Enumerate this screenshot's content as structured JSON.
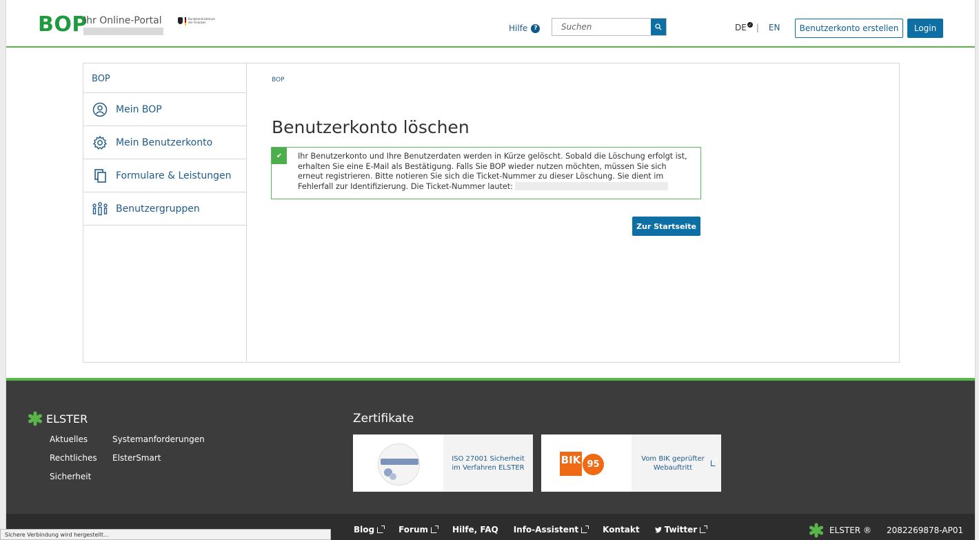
{
  "header": {
    "logo": "BOP",
    "portal_label": "Ihr Online-Portal",
    "ministry_text": "Bundesministerium der Finanzen",
    "help_label": "Hilfe",
    "search_placeholder": "Suchen",
    "lang_de": "DE",
    "lang_sep": "|",
    "lang_en": "EN",
    "create_account_label": "Benutzerkonto erstellen",
    "login_label": "Login"
  },
  "sidebar": {
    "heading": "BOP",
    "items": [
      {
        "label": "Mein BOP",
        "icon": "user-circle-icon"
      },
      {
        "label": "Mein Benutzerkonto",
        "icon": "gear-icon"
      },
      {
        "label": "Formulare & Leistungen",
        "icon": "documents-icon"
      },
      {
        "label": "Benutzergruppen",
        "icon": "user-group-icon"
      }
    ]
  },
  "main": {
    "breadcrumb": "BOP",
    "title": "Benutzerkonto löschen",
    "alert_text": "Ihr Benutzerkonto und Ihre Benutzerdaten werden in Kürze gelöscht. Sobald die Löschung erfolgt ist, erhalten Sie eine E-Mail als Bestätigung. Falls Sie BOP wieder nutzen möchten, müssen Sie sich erneut registrieren. Bitte notieren Sie sich die Ticket-Nummer zu dieser Löschung. Sie dient im Fehlerfall zur Identifizierung. Die Ticket-Nummer lautet:",
    "start_button_label": "Zur Startseite"
  },
  "footer": {
    "brand": "ELSTER",
    "links": [
      "Aktuelles",
      "Systemanforderungen",
      "Rechtliches",
      "ElsterSmart",
      "Sicherheit"
    ],
    "certificates_title": "Zertifikate",
    "cert1_text": "ISO 27001 Sicherheit im Verfahren ELSTER",
    "cert2_text": "Vom BIK geprüfter Webauftritt",
    "bik_label": "BIK",
    "bik_number": "95",
    "bottom_links": [
      "Blog",
      "Forum",
      "Hilfe, FAQ",
      "Info-Assistent",
      "Kontakt",
      "Twitter"
    ],
    "elster_trademark": "ELSTER ®",
    "build_id": "2082269878-AP01"
  },
  "status_bar": "Sichere Verbindung wird hergestellt...",
  "colors": {
    "brand_green": "#1f9a3e",
    "primary_blue": "#0d6fa4",
    "footer_bg": "#3c3c3c",
    "success_green": "#4cae4c"
  }
}
